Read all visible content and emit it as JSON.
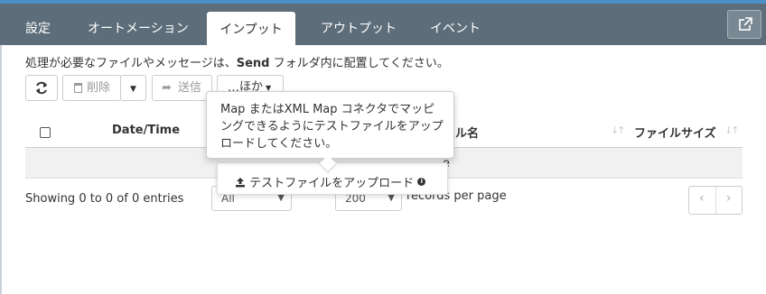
{
  "tabs": [
    {
      "label": "設定"
    },
    {
      "label": "オートメーション"
    },
    {
      "label": "インプット"
    },
    {
      "label": "アウトプット"
    },
    {
      "label": "イベント"
    }
  ],
  "info": {
    "prefix": "処理が必要なファイルやメッセージは、",
    "bold": "Send",
    "suffix": " フォルダ内に配置してください。"
  },
  "toolbar": {
    "delete_label": "削除",
    "send_label": "送信",
    "more_label": "ほか"
  },
  "table": {
    "columns": [
      {
        "label": "Date/Time"
      },
      {
        "label": "ル名"
      },
      {
        "label": "ファイルサイズ"
      }
    ],
    "empty_fragment": "e"
  },
  "footer": {
    "showing": "Showing 0 to 0 of 0 entries",
    "filter_value": "All",
    "page_size": "200",
    "records_per_page": "records per page",
    "prev": "‹",
    "next": "›"
  },
  "dropdown": {
    "upload_label": "テストファイルをアップロード"
  },
  "tooltip": {
    "text": "Map またはXML Map コネクタでマッピングできるようにテストファイルをアップロードしてください。"
  },
  "colors": {
    "tabbar": "#5d6d79",
    "accent_line": "#4a90c8"
  }
}
